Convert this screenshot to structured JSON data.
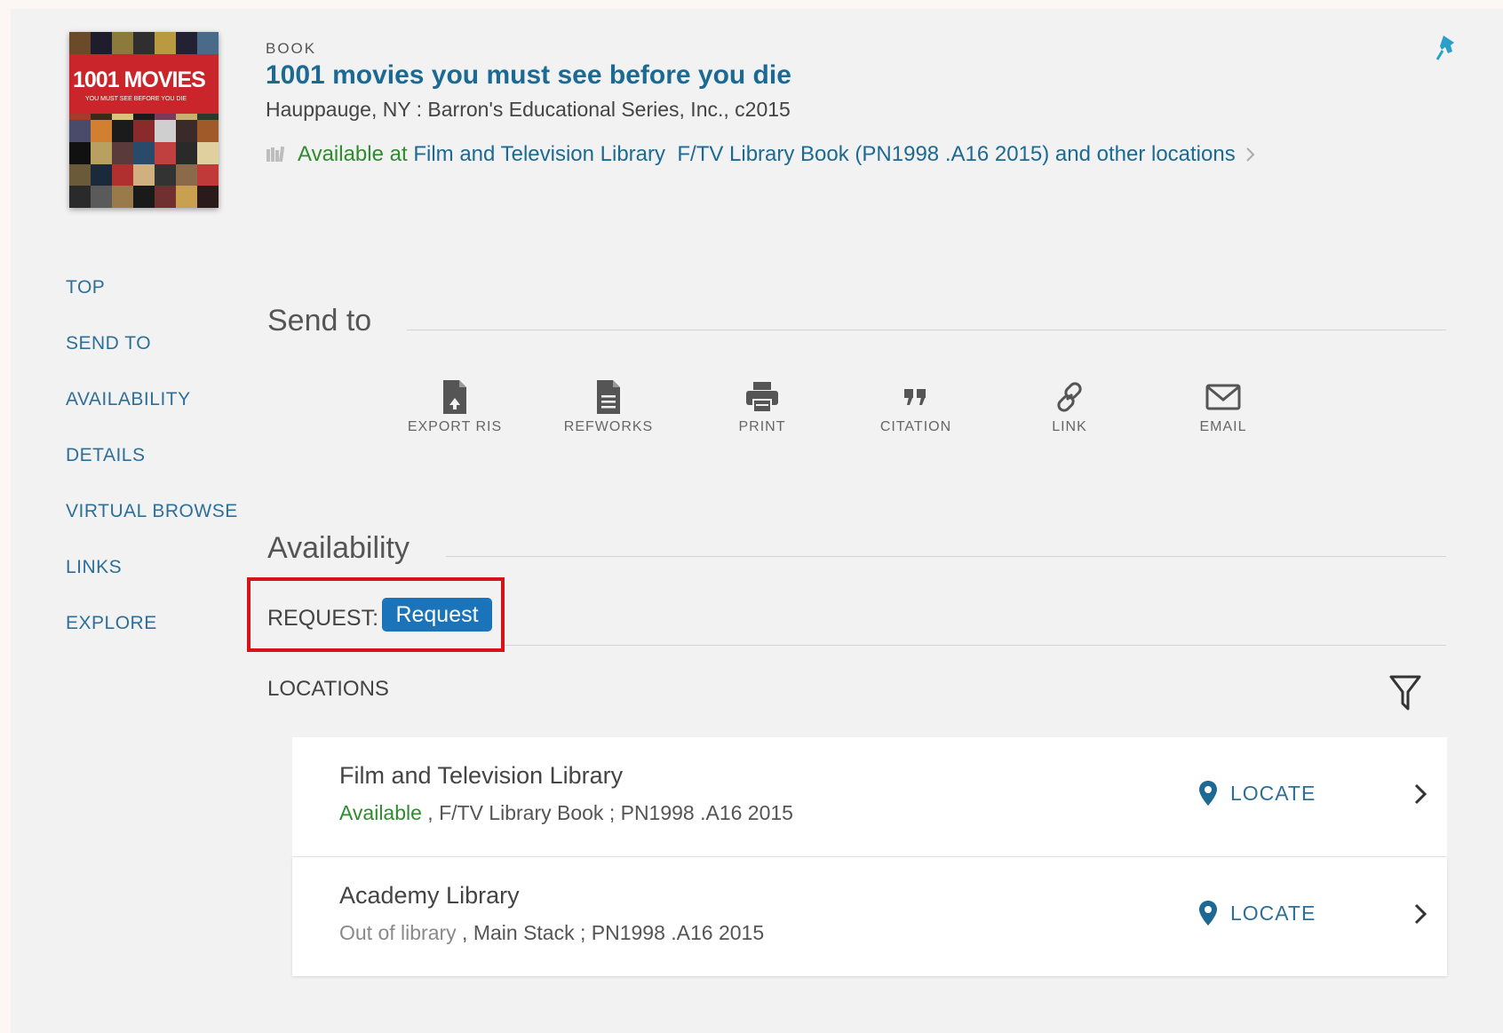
{
  "record": {
    "type": "BOOK",
    "title": "1001 movies you must see before you die",
    "publisher": "Hauppauge, NY : Barron's Educational Series, Inc., c2015",
    "availability": {
      "status": "Available at",
      "library": "Film and Television Library",
      "location": "F/TV Library Book (PN1998 .A16 2015)",
      "suffix": "and other locations"
    },
    "cover": {
      "title": "1001 MOVIES",
      "subtitle": "YOU MUST SEE BEFORE YOU DIE"
    }
  },
  "nav": [
    "TOP",
    "SEND TO",
    "AVAILABILITY",
    "DETAILS",
    "VIRTUAL BROWSE",
    "LINKS",
    "EXPLORE"
  ],
  "send_to": {
    "heading": "Send to",
    "actions": [
      {
        "label": "EXPORT RIS",
        "icon": "export-file-icon"
      },
      {
        "label": "REFWORKS",
        "icon": "document-icon"
      },
      {
        "label": "PRINT",
        "icon": "printer-icon"
      },
      {
        "label": "CITATION",
        "icon": "quote-icon"
      },
      {
        "label": "LINK",
        "icon": "link-icon"
      },
      {
        "label": "EMAIL",
        "icon": "envelope-icon"
      }
    ]
  },
  "availability_section": {
    "heading": "Availability",
    "request_label": "REQUEST:",
    "request_button": "Request",
    "locations_label": "LOCATIONS"
  },
  "locations": [
    {
      "name": "Film and Television Library",
      "status": "Available",
      "detail": " , F/TV Library Book ; PN1998 .A16 2015",
      "locate": "LOCATE"
    },
    {
      "name": "Academy Library",
      "status": "Out of library",
      "detail": " , Main Stack ; PN1998 .A16 2015",
      "locate": "LOCATE"
    }
  ],
  "colors": {
    "link": "#1c6a93",
    "available": "#2e8b2e",
    "button": "#1b74b9",
    "highlight": "#d4141b",
    "pin": "#2a9fc9"
  }
}
